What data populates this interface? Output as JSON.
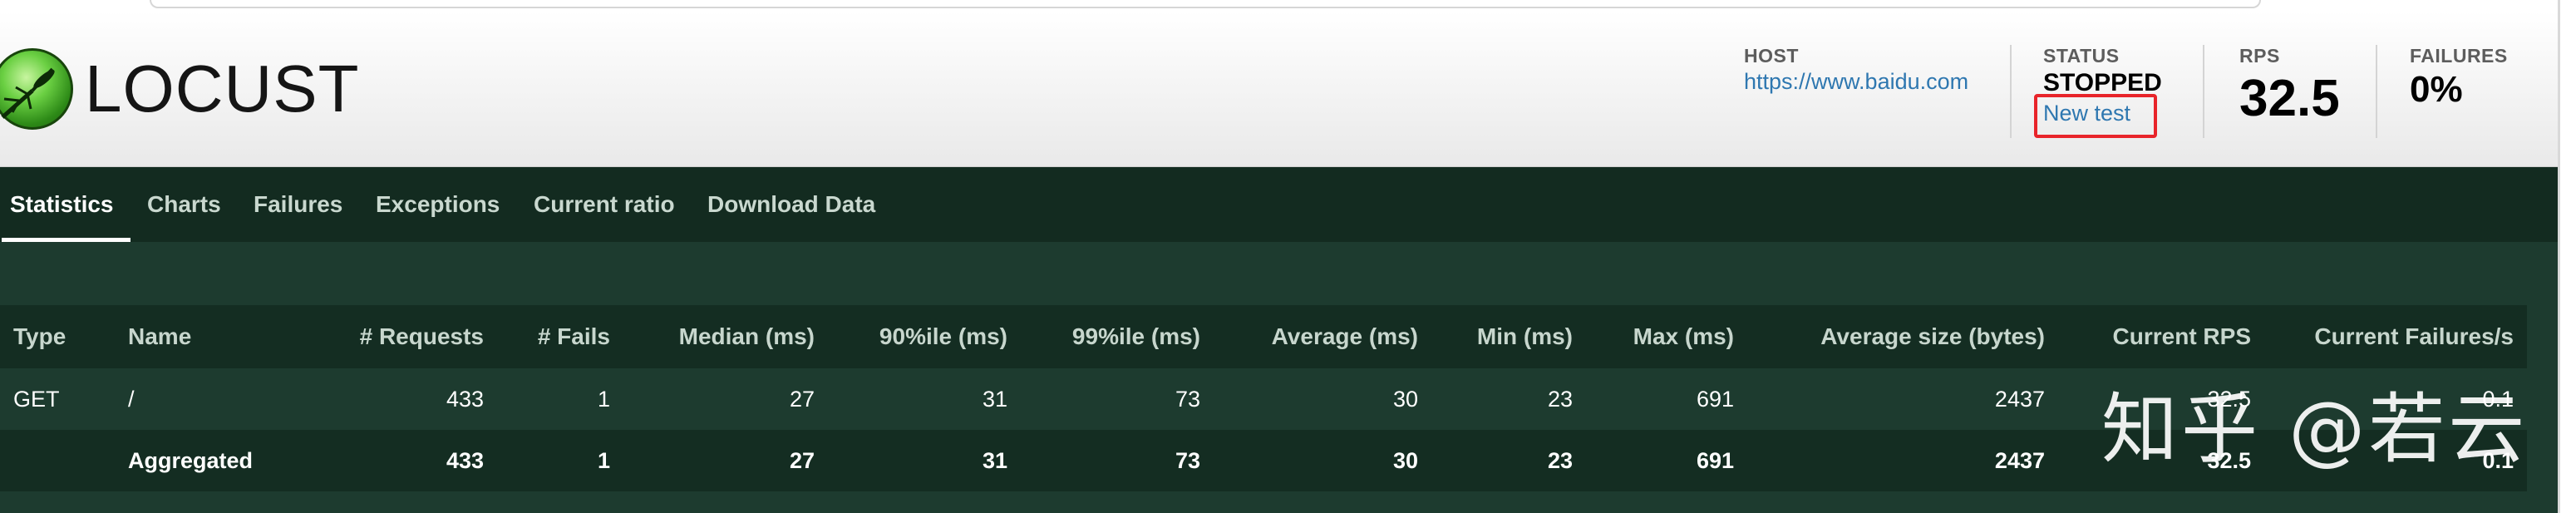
{
  "app": {
    "logo_text": "LOCUST"
  },
  "header": {
    "host_label": "HOST",
    "host_value": "https://www.baidu.com",
    "status_label": "STATUS",
    "status_value": "STOPPED",
    "new_test_link": "New test",
    "rps_label": "RPS",
    "rps_value": "32.5",
    "failures_label": "FAILURES",
    "failures_value": "0%",
    "highlight_color": "#e8242a"
  },
  "tabs": [
    {
      "label": "Statistics",
      "active": true
    },
    {
      "label": "Charts",
      "active": false
    },
    {
      "label": "Failures",
      "active": false
    },
    {
      "label": "Exceptions",
      "active": false
    },
    {
      "label": "Current ratio",
      "active": false
    },
    {
      "label": "Download Data",
      "active": false
    }
  ],
  "table": {
    "columns": [
      "Type",
      "Name",
      "# Requests",
      "# Fails",
      "Median (ms)",
      "90%ile (ms)",
      "99%ile (ms)",
      "Average (ms)",
      "Min (ms)",
      "Max (ms)",
      "Average size (bytes)",
      "Current RPS",
      "Current Failures/s"
    ],
    "rows": [
      [
        "GET",
        "/",
        "433",
        "1",
        "27",
        "31",
        "73",
        "30",
        "23",
        "691",
        "2437",
        "32.5",
        "0.1"
      ],
      [
        "",
        "Aggregated",
        "433",
        "1",
        "27",
        "31",
        "73",
        "30",
        "23",
        "691",
        "2437",
        "32.5",
        "0.1"
      ]
    ]
  },
  "watermark": "知乎 @若云",
  "colors": {
    "nav_bg": "#132b20",
    "main_bg": "#1d3b2f",
    "header_row_bg": "#142d22",
    "link": "#2e77b0"
  }
}
